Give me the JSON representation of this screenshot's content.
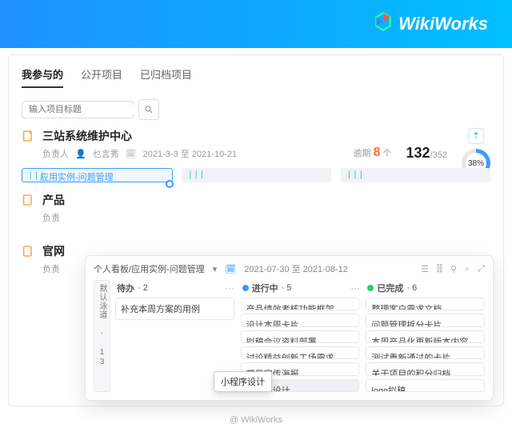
{
  "brand": "WikiWorks",
  "tabs": {
    "mine": "我参与的",
    "public": "公开项目",
    "archived": "已归档项目"
  },
  "search": {
    "placeholder": "输入项目标题"
  },
  "project1": {
    "title": "三站系统维护中心",
    "owner_label": "负责人",
    "owner_name": "乜言秀",
    "date_range": "2021-3-3 至 2021-10-21",
    "overdue_label": "逾期",
    "overdue_count": "8",
    "overdue_unit": "个",
    "done": "132",
    "total": "/352",
    "percent": "38%",
    "lane_label": "应用实例-问题管理"
  },
  "project2": {
    "title": "产品",
    "owner_label": "负责"
  },
  "project3": {
    "title": "官网",
    "owner_label": "负责"
  },
  "board": {
    "crumb": "个人看板/应用实例-问题管理",
    "date_range": "2021-07-30 至 2021-08-12",
    "swimlane": "默认泳道 · 13",
    "cols": {
      "todo": {
        "title": "待办",
        "count": "· 2"
      },
      "doing": {
        "title": "进行中",
        "count": "· 5"
      },
      "done": {
        "title": "已完成",
        "count": "· 6"
      }
    },
    "todo_cards": [
      "补充本周方案的用例"
    ],
    "doing_cards": [
      "产品绩效考核功能框架",
      "设计本周卡片",
      "拟稿会议资料部署",
      "讨论精益创新工场需求",
      "节日宣传海报",
      "小程序设计"
    ],
    "done_cards": [
      "整理客户需求文档",
      "问题管理拆分卡片",
      "本周产品化更新版本内容",
      "测试重新通过的卡片",
      "关于项目的积分归档",
      "logo拟稿"
    ],
    "dragging": "小程序设计"
  },
  "footer": "@ WikiWorks"
}
